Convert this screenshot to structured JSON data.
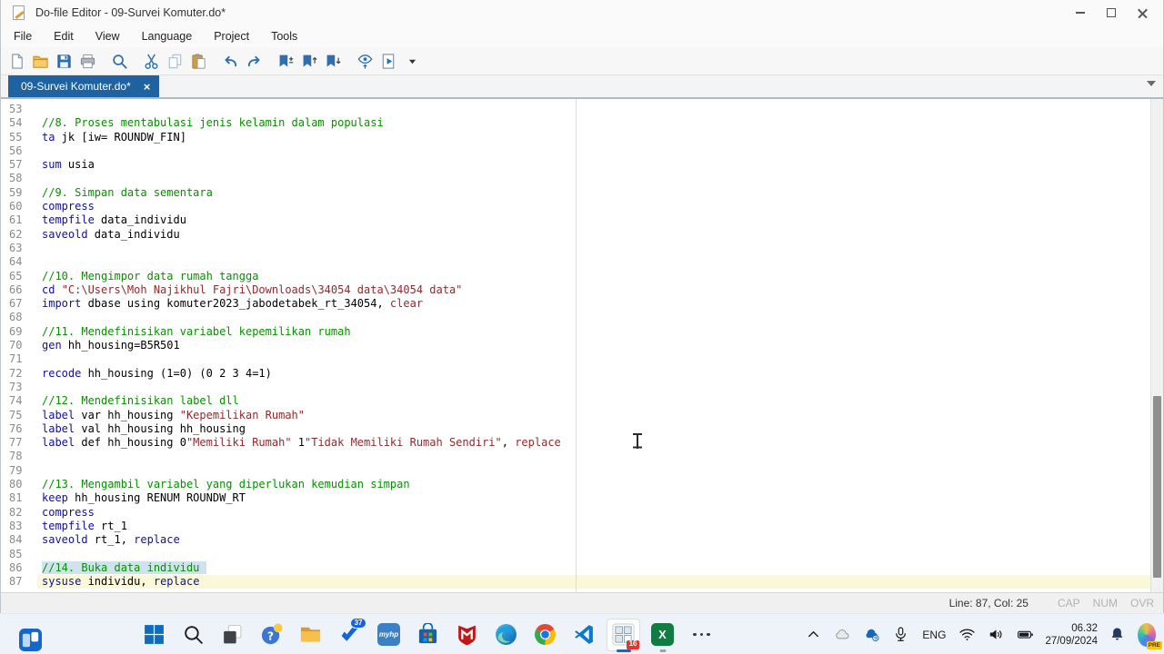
{
  "window": {
    "title": "Do-file Editor - 09-Survei Komuter.do*"
  },
  "menu": {
    "items": [
      "File",
      "Edit",
      "View",
      "Language",
      "Project",
      "Tools"
    ]
  },
  "toolbar": {
    "icons": [
      "new-do-file",
      "open",
      "save",
      "print",
      "find",
      "cut",
      "copy",
      "paste",
      "undo",
      "redo",
      "toggle-bookmark",
      "previous-bookmark",
      "next-bookmark",
      "preview",
      "execute-do",
      "more-options"
    ]
  },
  "tab": {
    "label": "09-Survei Komuter.do*",
    "close_glyph": "×"
  },
  "editor": {
    "lines": [
      {
        "num": 53,
        "segments": []
      },
      {
        "num": 54,
        "segments": [
          {
            "t": "//8. Proses mentabulasi jenis kelamin dalam populasi",
            "c": "c"
          }
        ]
      },
      {
        "num": 55,
        "segments": [
          {
            "t": "ta",
            "c": "k"
          },
          {
            "t": " jk [iw= ROUNDW_FIN]",
            "c": "n"
          }
        ]
      },
      {
        "num": 56,
        "segments": []
      },
      {
        "num": 57,
        "segments": [
          {
            "t": "sum",
            "c": "k"
          },
          {
            "t": " usia",
            "c": "n"
          }
        ]
      },
      {
        "num": 58,
        "segments": []
      },
      {
        "num": 59,
        "segments": [
          {
            "t": "//9. Simpan data sementara",
            "c": "c"
          }
        ]
      },
      {
        "num": 60,
        "segments": [
          {
            "t": "compress",
            "c": "k"
          }
        ]
      },
      {
        "num": 61,
        "segments": [
          {
            "t": "tempfile",
            "c": "k"
          },
          {
            "t": " data_individu",
            "c": "n"
          }
        ]
      },
      {
        "num": 62,
        "segments": [
          {
            "t": "saveold",
            "c": "k"
          },
          {
            "t": " data_individu",
            "c": "n"
          }
        ]
      },
      {
        "num": 63,
        "segments": []
      },
      {
        "num": 64,
        "segments": []
      },
      {
        "num": 65,
        "segments": [
          {
            "t": "//10. Mengimpor data rumah tangga",
            "c": "c"
          }
        ]
      },
      {
        "num": 66,
        "segments": [
          {
            "t": "cd",
            "c": "k"
          },
          {
            "t": " ",
            "c": "n"
          },
          {
            "t": "\"C:\\Users\\Moh Najikhul Fajri\\Downloads\\34054 data\\34054 data\"",
            "c": "s"
          }
        ]
      },
      {
        "num": 67,
        "segments": [
          {
            "t": "import",
            "c": "k"
          },
          {
            "t": " dbase using komuter2023_jabodetabek_rt_34054, ",
            "c": "n"
          },
          {
            "t": "clear",
            "c": "s"
          }
        ]
      },
      {
        "num": 68,
        "segments": []
      },
      {
        "num": 69,
        "segments": [
          {
            "t": "//11. Mendefinisikan variabel kepemilikan rumah",
            "c": "c"
          }
        ]
      },
      {
        "num": 70,
        "segments": [
          {
            "t": "gen",
            "c": "k"
          },
          {
            "t": " hh_housing=B5R501",
            "c": "n"
          }
        ]
      },
      {
        "num": 71,
        "segments": []
      },
      {
        "num": 72,
        "segments": [
          {
            "t": "recode",
            "c": "k"
          },
          {
            "t": " hh_housing (1=0) (0 2 3 4=1)",
            "c": "n"
          }
        ]
      },
      {
        "num": 73,
        "segments": []
      },
      {
        "num": 74,
        "segments": [
          {
            "t": "//12. Mendefinisikan label dll",
            "c": "c"
          }
        ]
      },
      {
        "num": 75,
        "segments": [
          {
            "t": "label",
            "c": "k"
          },
          {
            "t": " var hh_housing ",
            "c": "n"
          },
          {
            "t": "\"Kepemilikan Rumah\"",
            "c": "s"
          }
        ]
      },
      {
        "num": 76,
        "segments": [
          {
            "t": "label",
            "c": "k"
          },
          {
            "t": " val hh_housing hh_housing",
            "c": "n"
          }
        ]
      },
      {
        "num": 77,
        "segments": [
          {
            "t": "label",
            "c": "k"
          },
          {
            "t": " def hh_housing 0",
            "c": "n"
          },
          {
            "t": "\"Memiliki Rumah\"",
            "c": "s"
          },
          {
            "t": " 1",
            "c": "n"
          },
          {
            "t": "\"Tidak Memiliki Rumah Sendiri\"",
            "c": "s"
          },
          {
            "t": ", ",
            "c": "n"
          },
          {
            "t": "replace",
            "c": "s"
          }
        ]
      },
      {
        "num": 78,
        "segments": []
      },
      {
        "num": 79,
        "segments": []
      },
      {
        "num": 80,
        "segments": [
          {
            "t": "//13. Mengambil variabel yang diperlukan kemudian simpan",
            "c": "c"
          }
        ]
      },
      {
        "num": 81,
        "segments": [
          {
            "t": "keep",
            "c": "k"
          },
          {
            "t": " hh_housing RENUM ROUNDW_RT",
            "c": "n"
          }
        ]
      },
      {
        "num": 82,
        "segments": [
          {
            "t": "compress",
            "c": "k"
          }
        ]
      },
      {
        "num": 83,
        "segments": [
          {
            "t": "tempfile",
            "c": "k"
          },
          {
            "t": " rt_1",
            "c": "n"
          }
        ]
      },
      {
        "num": 84,
        "segments": [
          {
            "t": "saveold",
            "c": "k"
          },
          {
            "t": " rt_1, ",
            "c": "n"
          },
          {
            "t": "replace",
            "c": "k"
          }
        ]
      },
      {
        "num": 85,
        "segments": []
      },
      {
        "num": 86,
        "selected": true,
        "segments": [
          {
            "t": "//14. Buka data individu",
            "c": "c"
          }
        ]
      },
      {
        "num": 87,
        "current": true,
        "segments": [
          {
            "t": "sysuse",
            "c": "k"
          },
          {
            "t": " individu, ",
            "c": "n"
          },
          {
            "t": "replace",
            "c": "k"
          }
        ]
      }
    ]
  },
  "statusbar": {
    "line_col": "Line: 87, Col: 25",
    "cap": "CAP",
    "num": "NUM",
    "ovr": "OVR"
  },
  "taskbar": {
    "pinned": [
      "widgets",
      "start",
      "search",
      "task-view",
      "quiz",
      "file-explorer",
      "planner",
      "myhp",
      "microsoft-store",
      "mcafee",
      "edge",
      "chrome",
      "vscode",
      "stata",
      "excel",
      "more-apps"
    ],
    "badges": {
      "planner": "37",
      "stata": "16"
    },
    "myhp_label": "myhp",
    "language": "ENG",
    "time": "06.32",
    "date": "27/09/2024",
    "copilot_badge": "PRE"
  },
  "colors": {
    "tab_accent": "#1f62a2",
    "keyword": "#10109c",
    "comment": "#089000",
    "string": "#8f2b2b",
    "current_line": "#fbf8d9",
    "selection": "#cfe2ee"
  }
}
